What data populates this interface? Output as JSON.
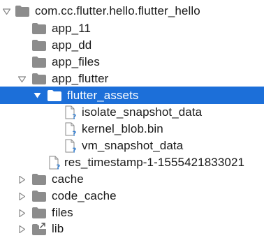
{
  "tree": {
    "root": {
      "label": "com.cc.flutter.hello.flutter_hello",
      "expanded": true
    },
    "items": [
      {
        "label": "app_11",
        "type": "folder"
      },
      {
        "label": "app_dd",
        "type": "folder"
      },
      {
        "label": "app_files",
        "type": "folder"
      },
      {
        "label": "app_flutter",
        "type": "folder",
        "expanded": true
      },
      {
        "label": "flutter_assets",
        "type": "folder",
        "expanded": true,
        "selected": true
      },
      {
        "label": "isolate_snapshot_data",
        "type": "unknown-file"
      },
      {
        "label": "kernel_blob.bin",
        "type": "unknown-file"
      },
      {
        "label": "vm_snapshot_data",
        "type": "unknown-file"
      },
      {
        "label": "res_timestamp-1-1555421833021",
        "type": "unknown-file"
      },
      {
        "label": "cache",
        "type": "folder",
        "expanded": false
      },
      {
        "label": "code_cache",
        "type": "folder",
        "expanded": false
      },
      {
        "label": "files",
        "type": "folder",
        "expanded": false
      },
      {
        "label": "lib",
        "type": "folder-link",
        "expanded": false
      }
    ]
  },
  "colors": {
    "selection": "#1c6fd9",
    "folder": "#8c8c8c",
    "arrow": "#888888",
    "unknown_badge": "#2f7fd6"
  }
}
